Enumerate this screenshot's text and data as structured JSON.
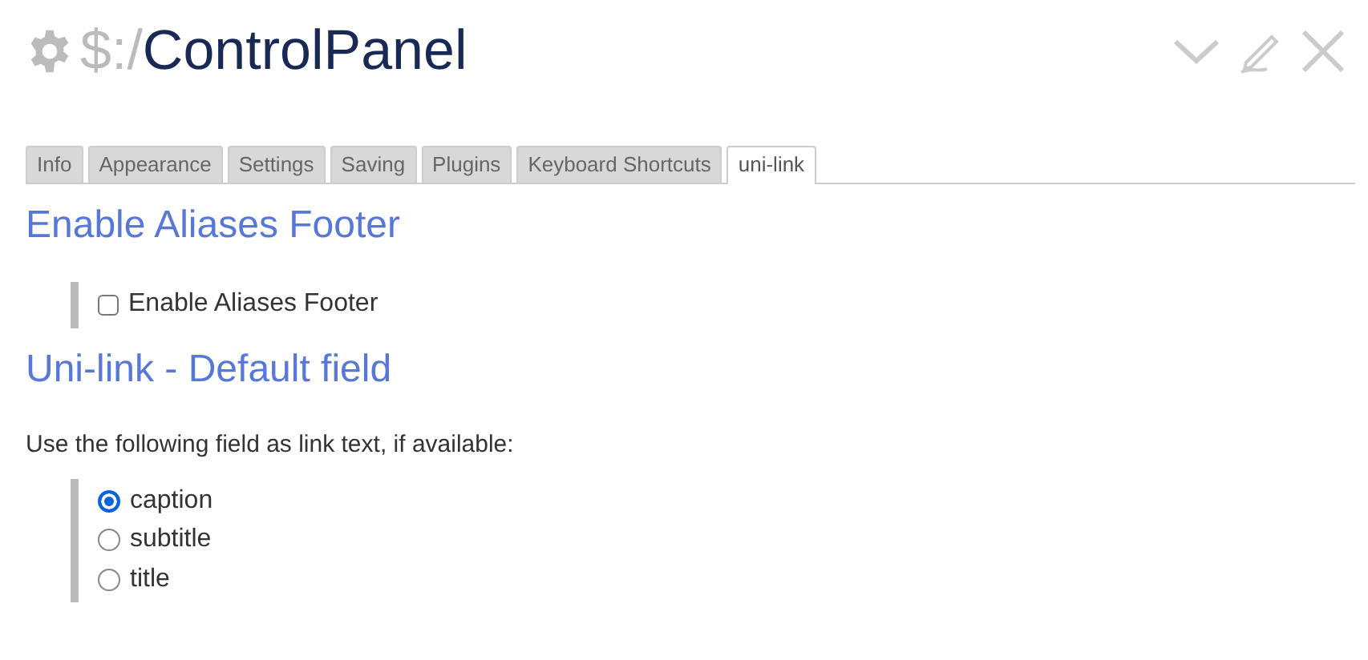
{
  "title": {
    "prefix": "$:/",
    "name": "ControlPanel"
  },
  "tabs": [
    {
      "label": "Info",
      "selected": false
    },
    {
      "label": "Appearance",
      "selected": false
    },
    {
      "label": "Settings",
      "selected": false
    },
    {
      "label": "Saving",
      "selected": false
    },
    {
      "label": "Plugins",
      "selected": false
    },
    {
      "label": "Keyboard Shortcuts",
      "selected": false
    },
    {
      "label": "uni-link",
      "selected": true
    }
  ],
  "sections": [
    {
      "heading": "Enable Aliases Footer",
      "options": [
        {
          "kind": "checkbox",
          "label": "Enable Aliases Footer",
          "checked": false
        }
      ]
    },
    {
      "heading": "Uni-link - Default field",
      "text": "Use the following field as link text, if available:",
      "options": [
        {
          "kind": "radio",
          "label": "caption",
          "selected": true
        },
        {
          "kind": "radio",
          "label": "subtitle",
          "selected": false
        },
        {
          "kind": "radio",
          "label": "title",
          "selected": false
        }
      ]
    }
  ]
}
